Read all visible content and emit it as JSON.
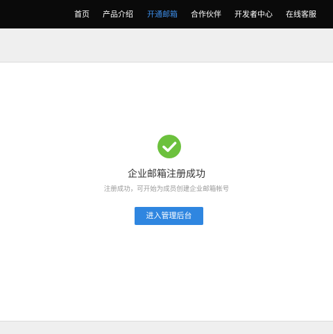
{
  "nav": {
    "items": [
      {
        "label": "首页",
        "active": false
      },
      {
        "label": "产品介绍",
        "active": false
      },
      {
        "label": "开通邮箱",
        "active": true
      },
      {
        "label": "合作伙伴",
        "active": false
      },
      {
        "label": "开发者中心",
        "active": false
      },
      {
        "label": "在线客服",
        "active": false
      }
    ]
  },
  "success": {
    "icon": "check-circle-icon",
    "title": "企业邮箱注册成功",
    "subtitle": "注册成功，可开始为成员创建企业邮箱帐号",
    "button_label": "进入管理后台"
  },
  "colors": {
    "topbar": "#0a0a0a",
    "nav_active": "#3c8ce6",
    "success_green": "#6cc13d",
    "button_blue": "#2f86e0"
  }
}
